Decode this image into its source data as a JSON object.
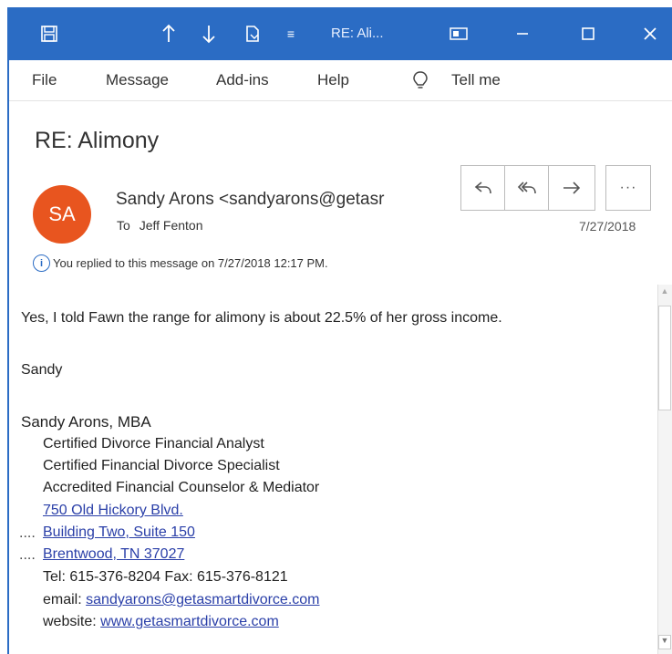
{
  "titlebar": {
    "title": "RE: Ali...",
    "icons": [
      "save-icon",
      "arrow-up-icon",
      "arrow-down-icon",
      "clipboard-icon",
      "customize-icon",
      "reading-pane-icon",
      "minimize-icon",
      "maximize-icon",
      "close-icon"
    ],
    "bg_color": "#2b6cc4"
  },
  "menu": {
    "items": [
      "File",
      "Message",
      "Add-ins",
      "Help"
    ],
    "tell_me": "Tell me"
  },
  "message": {
    "subject": "RE: Alimony",
    "avatar_initials": "SA",
    "avatar_color": "#e8551f",
    "sender": "Sandy Arons <sandyarons@getasr",
    "to_label": "To",
    "to_name": "Jeff Fenton",
    "date": "7/27/2018",
    "info": "You replied to this message on 7/27/2018 12:17 PM.",
    "actions": [
      "reply-icon",
      "reply-all-icon",
      "forward-icon",
      "more-icon"
    ],
    "more_label": "···"
  },
  "body": {
    "line1": "Yes, I told Fawn the range for alimony is about 22.5% of her gross income.",
    "line2": "Sandy"
  },
  "signature": {
    "name": "Sandy Arons, MBA",
    "title1": "Certified Divorce Financial Analyst",
    "title2": "Certified Financial Divorce Specialist",
    "title3": "Accredited Financial Counselor & Mediator",
    "address1": "750 Old Hickory Blvd.",
    "address2": "Building Two, Suite 150",
    "address3": "Brentwood, TN  37027",
    "phone": "Tel: 615-376-8204 Fax: 615-376-8121",
    "email_label": "email:",
    "email": "sandyarons@getasmartdivorce.com",
    "website_label": "website:",
    "website": "www.getasmartdivorce.com",
    "dots": "...."
  }
}
